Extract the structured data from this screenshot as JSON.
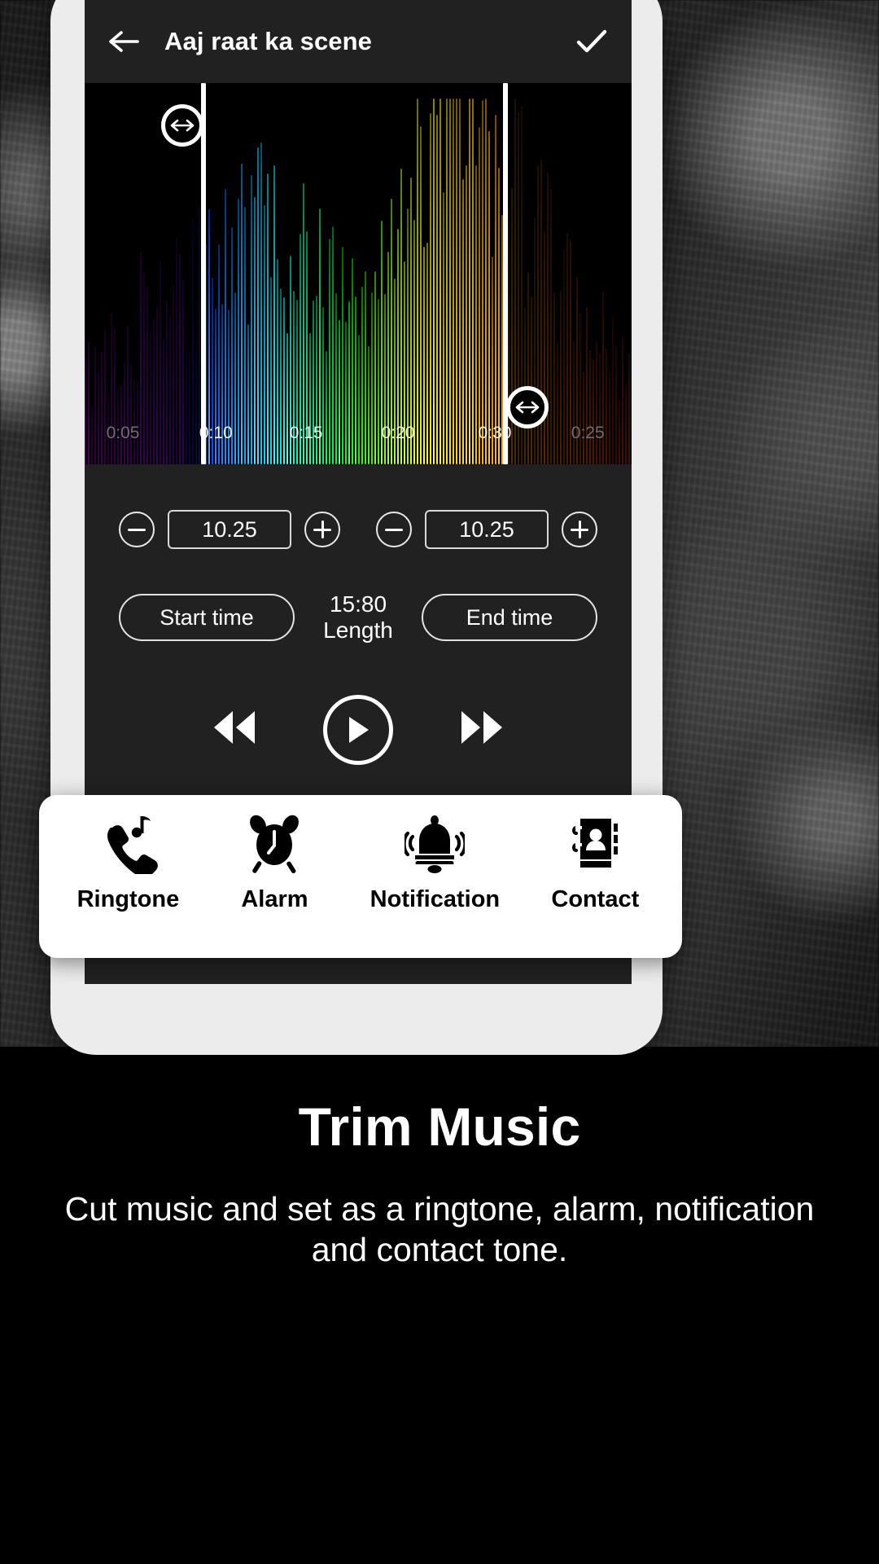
{
  "appbar": {
    "back_icon": "arrow-left-icon",
    "title": "Aaj raat ka scene",
    "done_icon": "check-icon"
  },
  "waveform": {
    "ticks": [
      {
        "label": "0:05",
        "dim": true,
        "pct": 7.0
      },
      {
        "label": "0:10",
        "dim": false,
        "pct": 24.0
      },
      {
        "label": "0:15",
        "dim": false,
        "pct": 40.5
      },
      {
        "label": "0:20",
        "dim": false,
        "pct": 57.3
      },
      {
        "label": "0:30",
        "dim": false,
        "pct": 75.0
      },
      {
        "label": "0:25",
        "dim": true,
        "pct": 92.0
      }
    ],
    "start_handle_pct": 21.8,
    "end_handle_pct": 77.0,
    "start_handle_icon": "resize-horizontal-icon",
    "end_handle_icon": "resize-horizontal-icon"
  },
  "steppers": {
    "start": {
      "minus_icon": "minus-circle-icon",
      "value": "10.25",
      "plus_icon": "plus-circle-icon"
    },
    "end": {
      "minus_icon": "minus-circle-icon",
      "value": "10.25",
      "plus_icon": "plus-circle-icon"
    }
  },
  "time_row": {
    "start_label": "Start time",
    "length_value": "15:80",
    "length_label": "Length",
    "end_label": "End time"
  },
  "player": {
    "rewind_icon": "rewind-icon",
    "play_icon": "play-icon",
    "forward_icon": "fast-forward-icon"
  },
  "sheet": {
    "items": [
      {
        "icon": "phone-music-icon",
        "label": "Ringtone"
      },
      {
        "icon": "alarm-clock-icon",
        "label": "Alarm"
      },
      {
        "icon": "bell-ring-icon",
        "label": "Notification"
      },
      {
        "icon": "contact-book-icon",
        "label": "Contact"
      }
    ]
  },
  "promo": {
    "headline": "Trim Music",
    "subtitle": "Cut music and set as a ringtone, alarm, notification and contact tone."
  },
  "colors": {
    "appbar_bg": "#212121",
    "screen_bg": "#1c1c1c",
    "wave_bg": "#000000",
    "sheet_bg": "#ffffff",
    "accent_white": "#ffffff",
    "frame": "#ececed"
  }
}
